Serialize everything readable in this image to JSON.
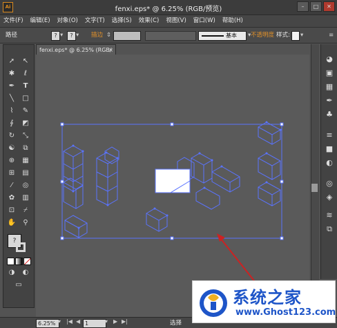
{
  "app": {
    "icon_text": "Ai",
    "title": "fenxi.eps* @ 6.25% (RGB/预览)"
  },
  "window_buttons": {
    "min": "–",
    "max": "□",
    "close": "✕"
  },
  "menu": [
    "文件(F)",
    "编辑(E)",
    "对象(O)",
    "文字(T)",
    "选择(S)",
    "效果(C)",
    "视图(V)",
    "窗口(W)",
    "帮助(H)"
  ],
  "control_bar": {
    "path_label": "路径",
    "fill_q": "?",
    "stroke_q": "?",
    "stroke_label": "描边",
    "brush_label": "基本",
    "opacity_label": "不透明度",
    "style_label": "样式:",
    "colors": {
      "accent_orange": "#e0902a"
    }
  },
  "document": {
    "tab_label": "fenxi.eps* @ 6.25% (RGB/预览)",
    "tab_close": "×"
  },
  "toolbox": {
    "icons": [
      "selection-icon",
      "direct-selection-icon",
      "magic-wand-icon",
      "lasso-icon",
      "pen-icon",
      "type-icon",
      "line-icon",
      "rectangle-icon",
      "paintbrush-icon",
      "pencil-icon",
      "blob-brush-icon",
      "eraser-icon",
      "rotate-icon",
      "scale-icon",
      "warp-icon",
      "free-transform-icon",
      "shape-builder-icon",
      "perspective-icon",
      "mesh-icon",
      "gradient-icon",
      "eyedropper-icon",
      "blend-icon",
      "symbol-sprayer-icon",
      "graph-icon",
      "artboard-icon",
      "slice-icon",
      "hand-icon",
      "zoom-icon"
    ],
    "fill_stroke_q": "?"
  },
  "right_panel_icons": [
    "color-icon",
    "color-guide-icon",
    "swatches-icon",
    "brushes-icon",
    "symbols-icon",
    "stroke-icon",
    "gradient-icon",
    "transparency-icon",
    "appearance-icon",
    "graphic-styles-icon",
    "layers-icon",
    "artboards-icon"
  ],
  "status": {
    "zoom": "6.25%",
    "page": "1",
    "tool_label": "选择"
  },
  "watermark": {
    "text": "系统之家",
    "url": "www.Ghost123.com"
  },
  "colors": {
    "selection_blue": "#5b74ff",
    "arrow_red": "#cc2222"
  }
}
